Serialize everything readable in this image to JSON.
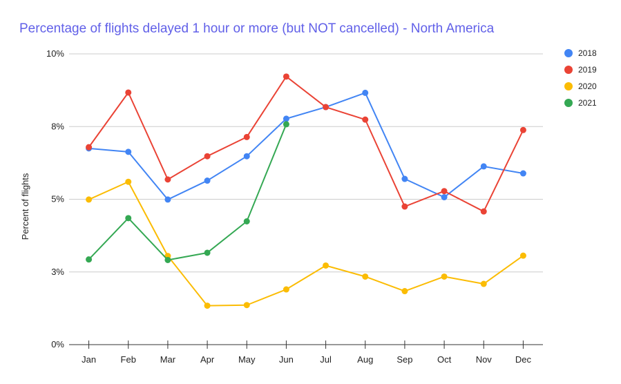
{
  "chart_data": {
    "type": "line",
    "title": "Percentage of flights delayed 1 hour or more (but NOT cancelled) - North America",
    "xlabel": "",
    "ylabel": "Percent of flights",
    "ylim": [
      0,
      10
    ],
    "yticks": [
      {
        "value": 0,
        "label": "0%"
      },
      {
        "value": 2.5,
        "label": "3%"
      },
      {
        "value": 5,
        "label": "5%"
      },
      {
        "value": 7.5,
        "label": "8%"
      },
      {
        "value": 10,
        "label": "10%"
      }
    ],
    "grid": true,
    "legend_position": "right",
    "categories": [
      "Jan",
      "Feb",
      "Mar",
      "Apr",
      "May",
      "Jun",
      "Jul",
      "Aug",
      "Sep",
      "Oct",
      "Nov",
      "Dec"
    ],
    "series": [
      {
        "name": "2018",
        "color": "#4285f4",
        "values": [
          6.75,
          6.63,
          4.99,
          5.64,
          6.48,
          7.77,
          8.17,
          8.66,
          5.7,
          5.07,
          6.13,
          5.89
        ]
      },
      {
        "name": "2019",
        "color": "#ea4335",
        "values": [
          6.79,
          8.67,
          5.68,
          6.48,
          7.14,
          9.22,
          8.17,
          7.74,
          4.75,
          5.28,
          4.58,
          7.38
        ]
      },
      {
        "name": "2020",
        "color": "#fbbc04",
        "values": [
          4.99,
          5.6,
          3.05,
          1.34,
          1.36,
          1.9,
          2.72,
          2.34,
          1.84,
          2.34,
          2.09,
          3.06
        ]
      },
      {
        "name": "2021",
        "color": "#34a853",
        "values": [
          2.93,
          4.35,
          2.91,
          3.16,
          4.24,
          7.58,
          null,
          null,
          null,
          null,
          null,
          null
        ]
      }
    ]
  }
}
